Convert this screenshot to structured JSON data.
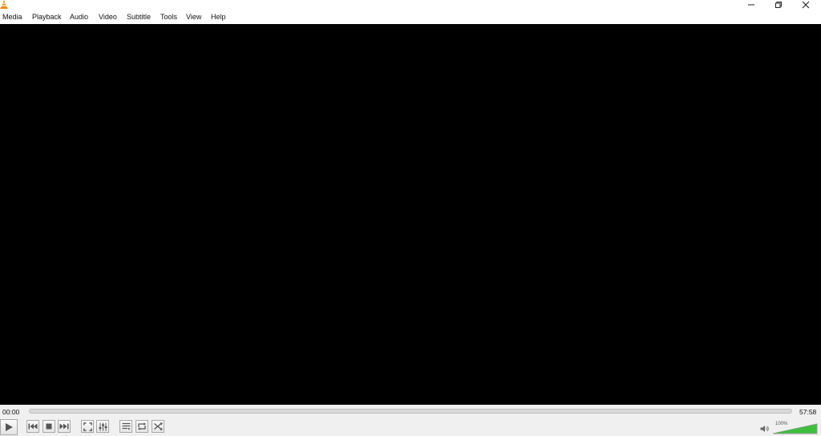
{
  "menu": {
    "items": [
      {
        "label": "Media"
      },
      {
        "label": "Playback"
      },
      {
        "label": "Audio"
      },
      {
        "label": "Video"
      },
      {
        "label": "Subtitle"
      },
      {
        "label": "Tools"
      },
      {
        "label": "View"
      },
      {
        "label": "Help"
      }
    ]
  },
  "window_controls": {
    "icons": [
      "minimize-icon",
      "restore-icon",
      "close-icon"
    ]
  },
  "playback": {
    "elapsed": "00:00",
    "total": "57:58",
    "progress": 0
  },
  "controls": {
    "icons": [
      "play-icon",
      "previous-icon",
      "stop-icon",
      "next-icon",
      "fullscreen-icon",
      "extended-settings-icon",
      "playlist-icon",
      "loop-icon",
      "shuffle-icon"
    ]
  },
  "volume": {
    "label": "100%",
    "level": 1.0,
    "fill_color": "#3cbf3c"
  },
  "colors": {
    "logo_orange": "#f08a00",
    "video_background": "#000000"
  }
}
